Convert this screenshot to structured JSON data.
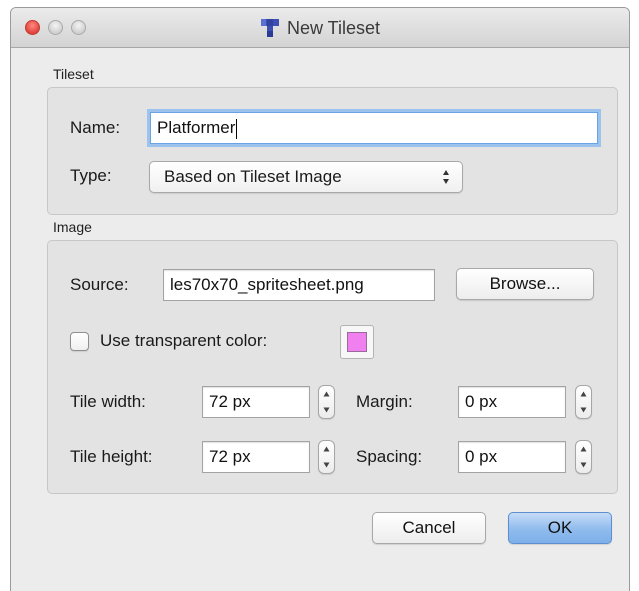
{
  "window": {
    "title": "New Tileset"
  },
  "tileset": {
    "section_label": "Tileset",
    "name_label": "Name:",
    "name_value": "Platformer",
    "type_label": "Type:",
    "type_value": "Based on Tileset Image"
  },
  "image": {
    "section_label": "Image",
    "source_label": "Source:",
    "source_value": "les70x70_spritesheet.png",
    "browse_label": "Browse...",
    "transparent_label": "Use transparent color:",
    "transparent_checked": false,
    "transparent_color": "#f07ff0",
    "tile_width_label": "Tile width:",
    "tile_width_value": "72 px",
    "tile_height_label": "Tile height:",
    "tile_height_value": "72 px",
    "margin_label": "Margin:",
    "margin_value": "0 px",
    "spacing_label": "Spacing:",
    "spacing_value": "0 px"
  },
  "footer": {
    "cancel_label": "Cancel",
    "ok_label": "OK"
  },
  "icons": {
    "close": "close-traffic-light",
    "minimize": "minimize-traffic-light",
    "maximize": "maximize-traffic-light",
    "app": "tiled-app-icon",
    "popup": "up-down-arrows-icon",
    "stepper": "stepper-arrows-icon"
  },
  "colors": {
    "accent": "#7eb0ea",
    "focus_ring": "#9cc3ee",
    "close_button": "#e0443e"
  }
}
